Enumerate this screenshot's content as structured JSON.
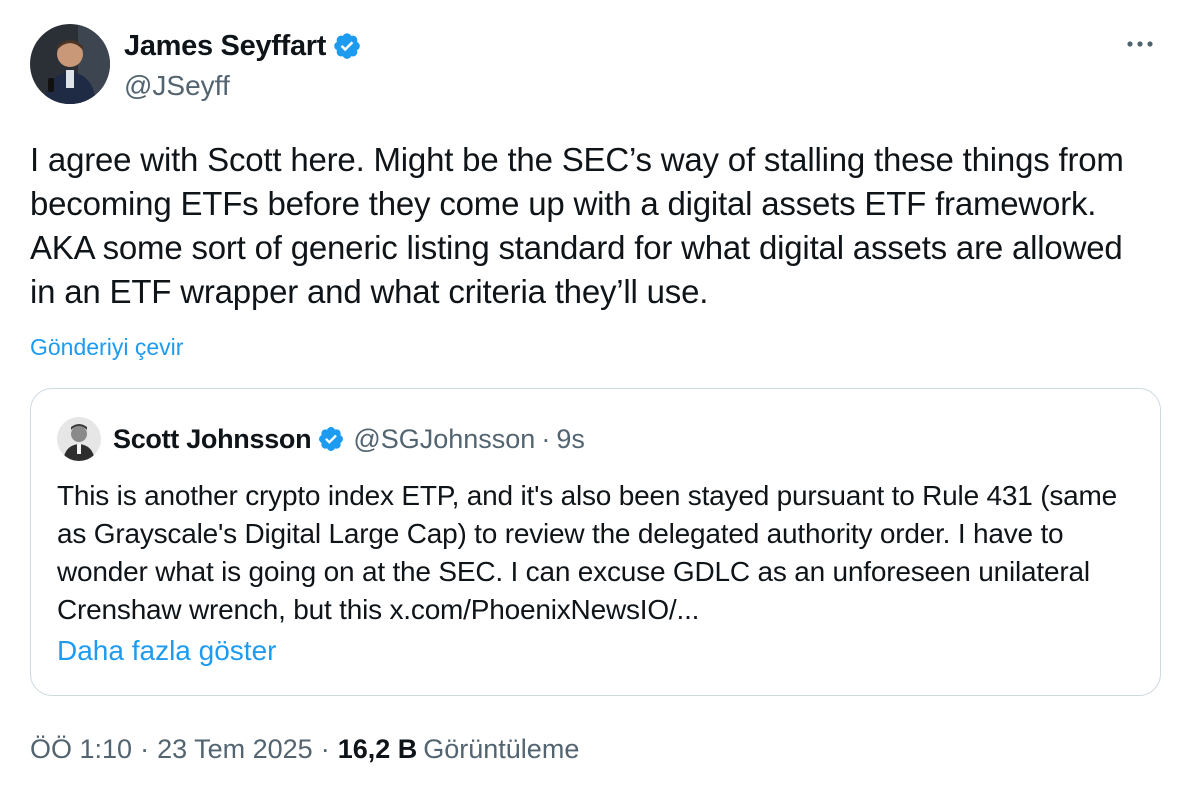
{
  "author": {
    "display_name": "James Seyffart",
    "handle": "@JSeyff",
    "verified": true,
    "avatar_icon": "avatar-photo"
  },
  "tweet": {
    "text": "I agree with Scott here. Might be the SEC’s way of stalling these things from becoming ETFs before they come up with a digital assets ETF framework. AKA some sort of generic listing standard for what digital assets are allowed in an ETF wrapper and what criteria they’ll use.",
    "translate_label": "Gönderiyi çevir"
  },
  "quote": {
    "display_name": "Scott Johnsson",
    "handle": "@SGJohnsson",
    "separator": "·",
    "time": "9s",
    "text": "This is another crypto index ETP, and it's also been stayed pursuant to Rule 431 (same as Grayscale's Digital Large Cap) to review the delegated authority order. I have to wonder what is going on at the SEC. I can excuse GDLC as an unforeseen unilateral Crenshaw wrench, but this x.com/PhoenixNewsIO/...",
    "show_more_label": "Daha fazla göster"
  },
  "footer": {
    "time": "ÖÖ 1:10",
    "separator1": "·",
    "date": "23 Tem 2025",
    "separator2": "·",
    "views_count": "16,2 B",
    "views_label": "Görüntüleme"
  },
  "colors": {
    "accent": "#1d9bf0",
    "secondary_text": "#536471",
    "border": "#cfd9de"
  },
  "icons": {
    "verified": "verified-badge-icon",
    "more": "more-horizontal-icon"
  }
}
